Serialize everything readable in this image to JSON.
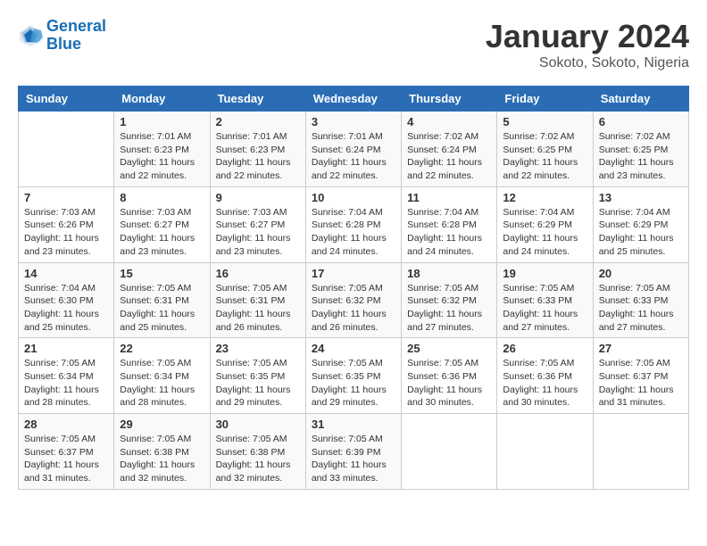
{
  "header": {
    "logo_line1": "General",
    "logo_line2": "Blue",
    "title": "January 2024",
    "subtitle": "Sokoto, Sokoto, Nigeria"
  },
  "weekdays": [
    "Sunday",
    "Monday",
    "Tuesday",
    "Wednesday",
    "Thursday",
    "Friday",
    "Saturday"
  ],
  "weeks": [
    [
      {
        "day": "",
        "sunrise": "",
        "sunset": "",
        "daylight": ""
      },
      {
        "day": "1",
        "sunrise": "7:01 AM",
        "sunset": "6:23 PM",
        "daylight": "11 hours and 22 minutes."
      },
      {
        "day": "2",
        "sunrise": "7:01 AM",
        "sunset": "6:23 PM",
        "daylight": "11 hours and 22 minutes."
      },
      {
        "day": "3",
        "sunrise": "7:01 AM",
        "sunset": "6:24 PM",
        "daylight": "11 hours and 22 minutes."
      },
      {
        "day": "4",
        "sunrise": "7:02 AM",
        "sunset": "6:24 PM",
        "daylight": "11 hours and 22 minutes."
      },
      {
        "day": "5",
        "sunrise": "7:02 AM",
        "sunset": "6:25 PM",
        "daylight": "11 hours and 22 minutes."
      },
      {
        "day": "6",
        "sunrise": "7:02 AM",
        "sunset": "6:25 PM",
        "daylight": "11 hours and 23 minutes."
      }
    ],
    [
      {
        "day": "7",
        "sunrise": "7:03 AM",
        "sunset": "6:26 PM",
        "daylight": "11 hours and 23 minutes."
      },
      {
        "day": "8",
        "sunrise": "7:03 AM",
        "sunset": "6:27 PM",
        "daylight": "11 hours and 23 minutes."
      },
      {
        "day": "9",
        "sunrise": "7:03 AM",
        "sunset": "6:27 PM",
        "daylight": "11 hours and 23 minutes."
      },
      {
        "day": "10",
        "sunrise": "7:04 AM",
        "sunset": "6:28 PM",
        "daylight": "11 hours and 24 minutes."
      },
      {
        "day": "11",
        "sunrise": "7:04 AM",
        "sunset": "6:28 PM",
        "daylight": "11 hours and 24 minutes."
      },
      {
        "day": "12",
        "sunrise": "7:04 AM",
        "sunset": "6:29 PM",
        "daylight": "11 hours and 24 minutes."
      },
      {
        "day": "13",
        "sunrise": "7:04 AM",
        "sunset": "6:29 PM",
        "daylight": "11 hours and 25 minutes."
      }
    ],
    [
      {
        "day": "14",
        "sunrise": "7:04 AM",
        "sunset": "6:30 PM",
        "daylight": "11 hours and 25 minutes."
      },
      {
        "day": "15",
        "sunrise": "7:05 AM",
        "sunset": "6:31 PM",
        "daylight": "11 hours and 25 minutes."
      },
      {
        "day": "16",
        "sunrise": "7:05 AM",
        "sunset": "6:31 PM",
        "daylight": "11 hours and 26 minutes."
      },
      {
        "day": "17",
        "sunrise": "7:05 AM",
        "sunset": "6:32 PM",
        "daylight": "11 hours and 26 minutes."
      },
      {
        "day": "18",
        "sunrise": "7:05 AM",
        "sunset": "6:32 PM",
        "daylight": "11 hours and 27 minutes."
      },
      {
        "day": "19",
        "sunrise": "7:05 AM",
        "sunset": "6:33 PM",
        "daylight": "11 hours and 27 minutes."
      },
      {
        "day": "20",
        "sunrise": "7:05 AM",
        "sunset": "6:33 PM",
        "daylight": "11 hours and 27 minutes."
      }
    ],
    [
      {
        "day": "21",
        "sunrise": "7:05 AM",
        "sunset": "6:34 PM",
        "daylight": "11 hours and 28 minutes."
      },
      {
        "day": "22",
        "sunrise": "7:05 AM",
        "sunset": "6:34 PM",
        "daylight": "11 hours and 28 minutes."
      },
      {
        "day": "23",
        "sunrise": "7:05 AM",
        "sunset": "6:35 PM",
        "daylight": "11 hours and 29 minutes."
      },
      {
        "day": "24",
        "sunrise": "7:05 AM",
        "sunset": "6:35 PM",
        "daylight": "11 hours and 29 minutes."
      },
      {
        "day": "25",
        "sunrise": "7:05 AM",
        "sunset": "6:36 PM",
        "daylight": "11 hours and 30 minutes."
      },
      {
        "day": "26",
        "sunrise": "7:05 AM",
        "sunset": "6:36 PM",
        "daylight": "11 hours and 30 minutes."
      },
      {
        "day": "27",
        "sunrise": "7:05 AM",
        "sunset": "6:37 PM",
        "daylight": "11 hours and 31 minutes."
      }
    ],
    [
      {
        "day": "28",
        "sunrise": "7:05 AM",
        "sunset": "6:37 PM",
        "daylight": "11 hours and 31 minutes."
      },
      {
        "day": "29",
        "sunrise": "7:05 AM",
        "sunset": "6:38 PM",
        "daylight": "11 hours and 32 minutes."
      },
      {
        "day": "30",
        "sunrise": "7:05 AM",
        "sunset": "6:38 PM",
        "daylight": "11 hours and 32 minutes."
      },
      {
        "day": "31",
        "sunrise": "7:05 AM",
        "sunset": "6:39 PM",
        "daylight": "11 hours and 33 minutes."
      },
      {
        "day": "",
        "sunrise": "",
        "sunset": "",
        "daylight": ""
      },
      {
        "day": "",
        "sunrise": "",
        "sunset": "",
        "daylight": ""
      },
      {
        "day": "",
        "sunrise": "",
        "sunset": "",
        "daylight": ""
      }
    ]
  ]
}
